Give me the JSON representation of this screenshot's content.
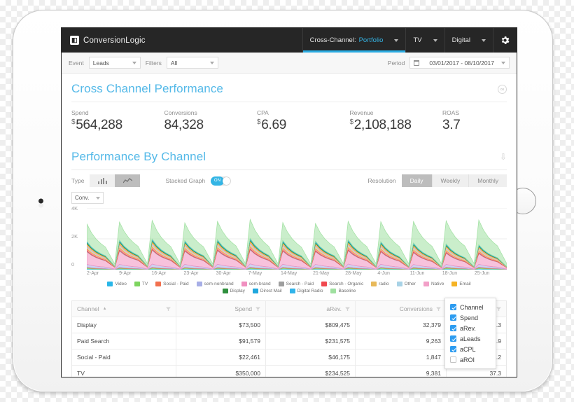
{
  "app": {
    "brand": "ConversionLogic",
    "brand_icon": "logo-mark-icon"
  },
  "topnav": {
    "tabs": [
      {
        "label_prefix": "Cross-Channel:",
        "label_accent": "Portfolio",
        "active": true,
        "name": "cross-channel"
      },
      {
        "label_prefix": "TV",
        "label_accent": "",
        "active": false,
        "name": "tv"
      },
      {
        "label_prefix": "Digital",
        "label_accent": "",
        "active": false,
        "name": "digital"
      }
    ],
    "settings_icon": "gear-icon"
  },
  "filterbar": {
    "event_label": "Event",
    "event_value": "Leads",
    "filters_label": "Filters",
    "filters_value": "All",
    "period_label": "Period",
    "period_value": "03/01/2017 - 08/10/2017",
    "calendar_icon": "calendar-icon"
  },
  "cross_channel": {
    "title": "Cross Channel Performance",
    "action_icon": "link-icon",
    "kpis": [
      {
        "label": "Spend",
        "currency": "$",
        "value": "564,288"
      },
      {
        "label": "Conversions",
        "currency": "",
        "value": "84,328"
      },
      {
        "label": "CPA",
        "currency": "$",
        "value": "6.69"
      },
      {
        "label": "Revenue",
        "currency": "$",
        "value": "2,108,188"
      },
      {
        "label": "ROAS",
        "currency": "",
        "value": "3.7"
      }
    ]
  },
  "performance": {
    "title": "Performance By Channel",
    "action_icon": "download-icon",
    "type_label": "Type",
    "type_options": [
      {
        "icon": "bar-chart-icon",
        "selected": false
      },
      {
        "icon": "line-chart-icon",
        "selected": true
      }
    ],
    "stacked_label": "Stacked Graph",
    "stacked_state": "ON",
    "resolution_label": "Resolution",
    "resolution_options": [
      {
        "label": "Daily",
        "selected": true
      },
      {
        "label": "Weekly",
        "selected": false
      },
      {
        "label": "Monthly",
        "selected": false
      }
    ],
    "metric_value": "Conv."
  },
  "chart_data": {
    "type": "area",
    "title": "Performance By Channel",
    "xlabel": "",
    "ylabel": "",
    "ylim": [
      0,
      4000
    ],
    "yticks": [
      "0",
      "2K",
      "4K"
    ],
    "grid": true,
    "legend_position": "bottom",
    "stacked": true,
    "x": [
      "2-Apr",
      "9-Apr",
      "16-Apr",
      "23-Apr",
      "30-Apr",
      "7-May",
      "14-May",
      "21-May",
      "28-May",
      "4-Jun",
      "11-Jun",
      "18-Jun",
      "25-Jun"
    ],
    "series": [
      {
        "name": "Video",
        "color": "#29b6e8",
        "values": [
          60,
          55,
          58,
          60,
          57,
          62,
          60,
          58,
          62,
          60,
          58,
          62,
          65
        ]
      },
      {
        "name": "TV",
        "color": "#7dd45f",
        "values": [
          50,
          48,
          52,
          50,
          49,
          53,
          51,
          50,
          52,
          51,
          49,
          53,
          55
        ]
      },
      {
        "name": "Social - Paid",
        "color": "#f2704e",
        "values": [
          40,
          38,
          42,
          40,
          39,
          43,
          41,
          40,
          42,
          41,
          39,
          43,
          45
        ]
      },
      {
        "name": "sem-nonbrand",
        "color": "#a7aee6",
        "values": [
          190,
          200,
          210,
          195,
          205,
          215,
          200,
          195,
          205,
          200,
          190,
          185,
          180
        ]
      },
      {
        "name": "sem-brand",
        "color": "#f08fc0",
        "values": [
          820,
          870,
          900,
          850,
          880,
          910,
          840,
          830,
          870,
          800,
          760,
          720,
          690
        ]
      },
      {
        "name": "Search - Paid",
        "color": "#9e9e9e",
        "values": [
          45,
          46,
          48,
          45,
          47,
          49,
          46,
          45,
          47,
          45,
          43,
          42,
          40
        ]
      },
      {
        "name": "Search - Organic",
        "color": "#f0484f",
        "values": [
          150,
          160,
          165,
          155,
          162,
          170,
          158,
          152,
          160,
          150,
          142,
          136,
          130
        ]
      },
      {
        "name": "radio",
        "color": "#e8b95a",
        "values": [
          130,
          135,
          140,
          132,
          138,
          145,
          134,
          130,
          136,
          128,
          122,
          118,
          112
        ]
      },
      {
        "name": "Other",
        "color": "#a8d2e6",
        "values": [
          60,
          62,
          64,
          61,
          63,
          66,
          62,
          60,
          63,
          59,
          56,
          54,
          52
        ]
      },
      {
        "name": "Native",
        "color": "#f2a0c8",
        "values": [
          55,
          57,
          59,
          56,
          58,
          61,
          57,
          55,
          58,
          54,
          51,
          49,
          47
        ]
      },
      {
        "name": "Email",
        "color": "#f5b324",
        "values": [
          95,
          98,
          102,
          97,
          100,
          105,
          98,
          95,
          100,
          93,
          88,
          85,
          81
        ]
      },
      {
        "name": "Display",
        "color": "#2f8f3d",
        "values": [
          70,
          72,
          75,
          71,
          74,
          77,
          72,
          70,
          74,
          69,
          65,
          63,
          60
        ]
      },
      {
        "name": "Direct Mail",
        "color": "#1fa7dd",
        "values": [
          30,
          31,
          32,
          30,
          31,
          33,
          31,
          30,
          32,
          29,
          28,
          27,
          26
        ]
      },
      {
        "name": "Digital Radio",
        "color": "#31b4ea",
        "values": [
          35,
          36,
          37,
          35,
          36,
          38,
          36,
          35,
          37,
          34,
          33,
          32,
          31
        ]
      },
      {
        "name": "Baseline",
        "color": "#9fe0a0",
        "values": [
          1150,
          1180,
          1210,
          1160,
          1190,
          1230,
          1170,
          1150,
          1200,
          1300,
          1400,
          1500,
          1600
        ]
      }
    ],
    "legend": [
      {
        "label": "Video",
        "color": "#29b6e8"
      },
      {
        "label": "TV",
        "color": "#7dd45f"
      },
      {
        "label": "Social - Paid",
        "color": "#f2704e"
      },
      {
        "label": "sem-nonbrand",
        "color": "#a7aee6"
      },
      {
        "label": "sem-brand",
        "color": "#f08fc0"
      },
      {
        "label": "Search - Paid",
        "color": "#9e9e9e"
      },
      {
        "label": "Search - Organic",
        "color": "#f0484f"
      },
      {
        "label": "radio",
        "color": "#e8b95a"
      },
      {
        "label": "Other",
        "color": "#a8d2e6"
      },
      {
        "label": "Native",
        "color": "#f2a0c8"
      },
      {
        "label": "Email",
        "color": "#f5b324"
      },
      {
        "label": "Display",
        "color": "#2f8f3d"
      },
      {
        "label": "Direct Mail",
        "color": "#1fa7dd"
      },
      {
        "label": "Digital Radio",
        "color": "#31b4ea"
      },
      {
        "label": "Baseline",
        "color": "#9fe0a0"
      }
    ]
  },
  "table": {
    "columns": [
      {
        "label": "Channel",
        "sorted": true,
        "filter_icon": "funnel-icon"
      },
      {
        "label": "Spend",
        "sorted": false,
        "filter_icon": "funnel-icon"
      },
      {
        "label": "aRev.",
        "sorted": false,
        "filter_icon": "funnel-icon"
      },
      {
        "label": "Conversions",
        "sorted": false,
        "filter_icon": "funnel-icon"
      },
      {
        "label": "",
        "sorted": false,
        "filter_icon": "funnel-icon"
      }
    ],
    "rows": [
      {
        "channel": "Display",
        "spend": "$73,500",
        "arev": "$809,475",
        "conversions": "32,379",
        "last": "2.3"
      },
      {
        "channel": "Paid Search",
        "spend": "$91,579",
        "arev": "$231,575",
        "conversions": "9,263",
        "last": "9.9"
      },
      {
        "channel": "Social - Paid",
        "spend": "$22,461",
        "arev": "$46,175",
        "conversions": "1,847",
        "last": "2.2"
      },
      {
        "channel": "TV",
        "spend": "$350,000",
        "arev": "$234,525",
        "conversions": "9,381",
        "last": "37.3"
      }
    ]
  },
  "column_dropdown": {
    "items": [
      {
        "label": "Channel",
        "checked": true
      },
      {
        "label": "Spend",
        "checked": true
      },
      {
        "label": "aRev.",
        "checked": true
      },
      {
        "label": "aLeads",
        "checked": true
      },
      {
        "label": "aCPL",
        "checked": true
      },
      {
        "label": "aROI",
        "checked": false
      }
    ]
  },
  "colors": {
    "accent": "#54b9e8",
    "nav_bg": "#262626",
    "toggle_on": "#33b5e5",
    "checkbox_on": "#2d9cf0"
  }
}
